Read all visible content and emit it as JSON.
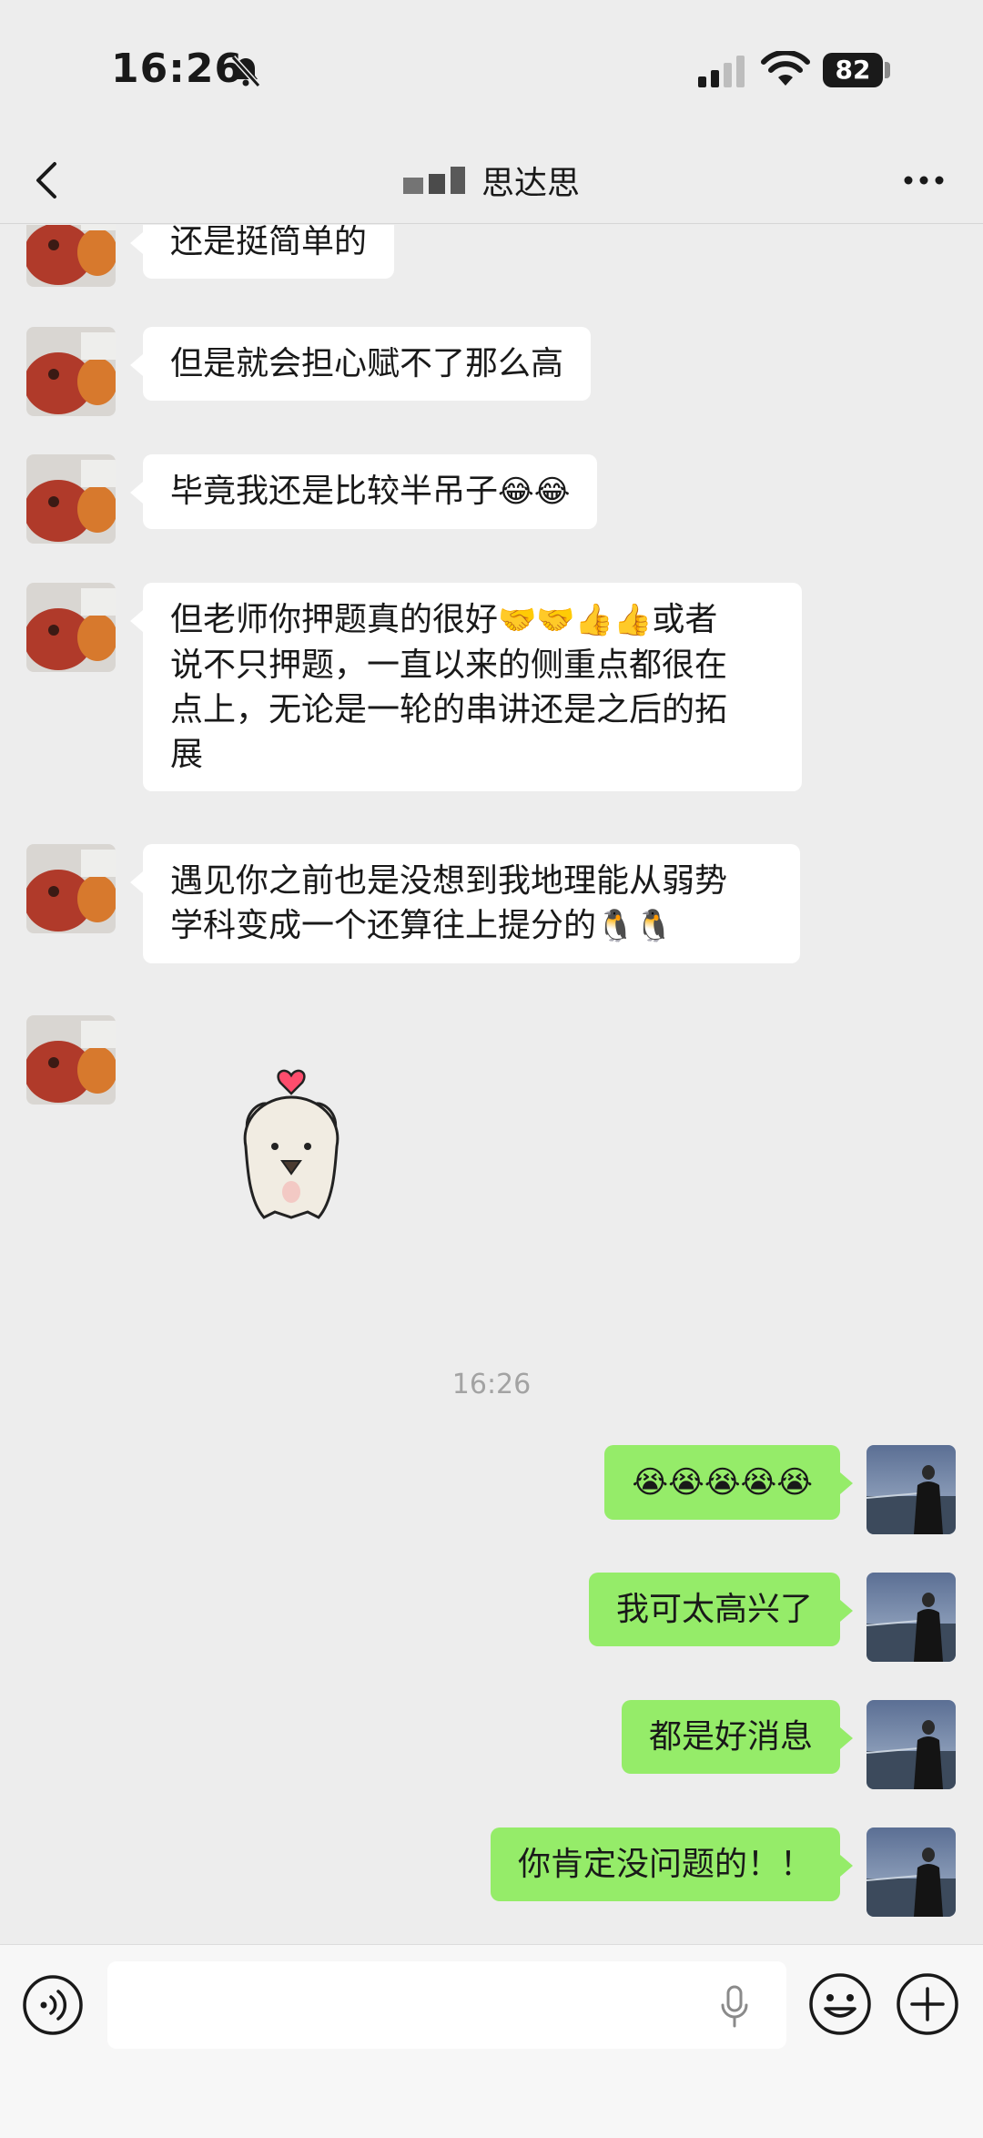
{
  "status_bar": {
    "time": "16:26",
    "battery": "82"
  },
  "header": {
    "title": "思达思"
  },
  "messages": [
    {
      "side": "in",
      "text": "还是挺简单的"
    },
    {
      "side": "in",
      "text": "但是就会担心赋不了那么高"
    },
    {
      "side": "in",
      "text": "毕竟我还是比较半吊子",
      "emoji": "😂😂"
    },
    {
      "side": "in",
      "line1": "但老师你押题真的很好",
      "line1_emoji": "🤝🤝👍👍",
      "line1_tail": "或者",
      "line2": "说不只押题，一直以来的侧重点都很在",
      "line3": "点上，无论是一轮的串讲还是之后的拓",
      "line4": "展"
    },
    {
      "side": "in",
      "line1": "遇见你之前也是没想到我地理能从弱势",
      "line2": "学科变成一个还算往上提分的",
      "line2_emoji": "🐧🐧"
    },
    {
      "side": "in",
      "type": "sticker",
      "sticker_icon": "white-cat-heart-sticker"
    },
    {
      "side": "out",
      "emoji": "😭😭😭😭😭"
    },
    {
      "side": "out",
      "text": "我可太高兴了"
    },
    {
      "side": "out",
      "text": "都是好消息"
    },
    {
      "side": "out",
      "text": "你肯定没问题的！！"
    }
  ],
  "timestamp": "16:26",
  "colors": {
    "background": "#ededed",
    "bubble_in": "#ffffff",
    "bubble_out": "#95ec69"
  }
}
